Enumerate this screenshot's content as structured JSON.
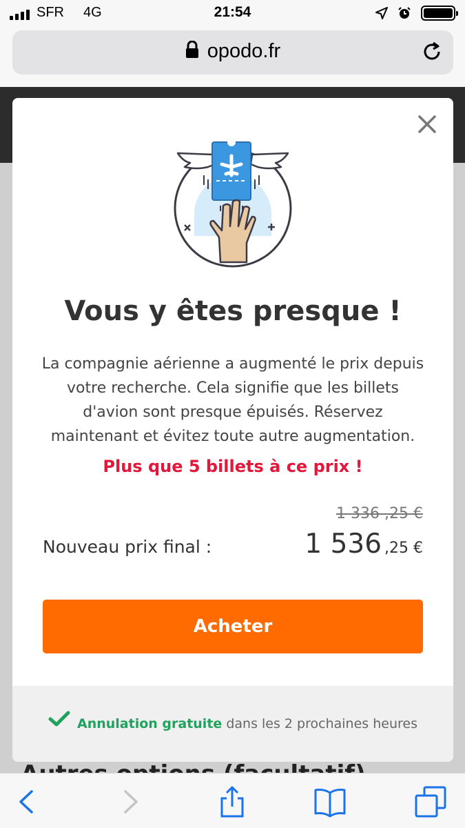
{
  "status_bar": {
    "carrier": "SFR",
    "network": "4G",
    "time": "21:54",
    "icons": [
      "signal-icon",
      "location-icon",
      "alarm-icon",
      "battery-icon"
    ]
  },
  "browser": {
    "url": "opodo.fr"
  },
  "background_page": {
    "peek_text": "Autres options (facultatif)"
  },
  "modal": {
    "title": "Vous y êtes presque !",
    "description": "La compagnie aérienne a augmenté le prix depuis votre recherche. Cela signifie que les billets d'avion sont presque épuisés. Réservez maintenant et évitez toute autre augmentation.",
    "warning": "Plus que 5 billets à ce prix !",
    "old_price": "1 336 ,25 €",
    "new_price_label": "Nouveau prix final :",
    "new_price_main": "1 536",
    "new_price_cents": ",25 €",
    "buy_label": "Acheter",
    "footer_highlight": "Annulation gratuite",
    "footer_rest": " dans les 2 prochaines heures"
  },
  "colors": {
    "accent_orange": "#ff6b00",
    "warning_red": "#e2173a",
    "success_green": "#1fa25e",
    "ticket_blue": "#3a97e0"
  }
}
